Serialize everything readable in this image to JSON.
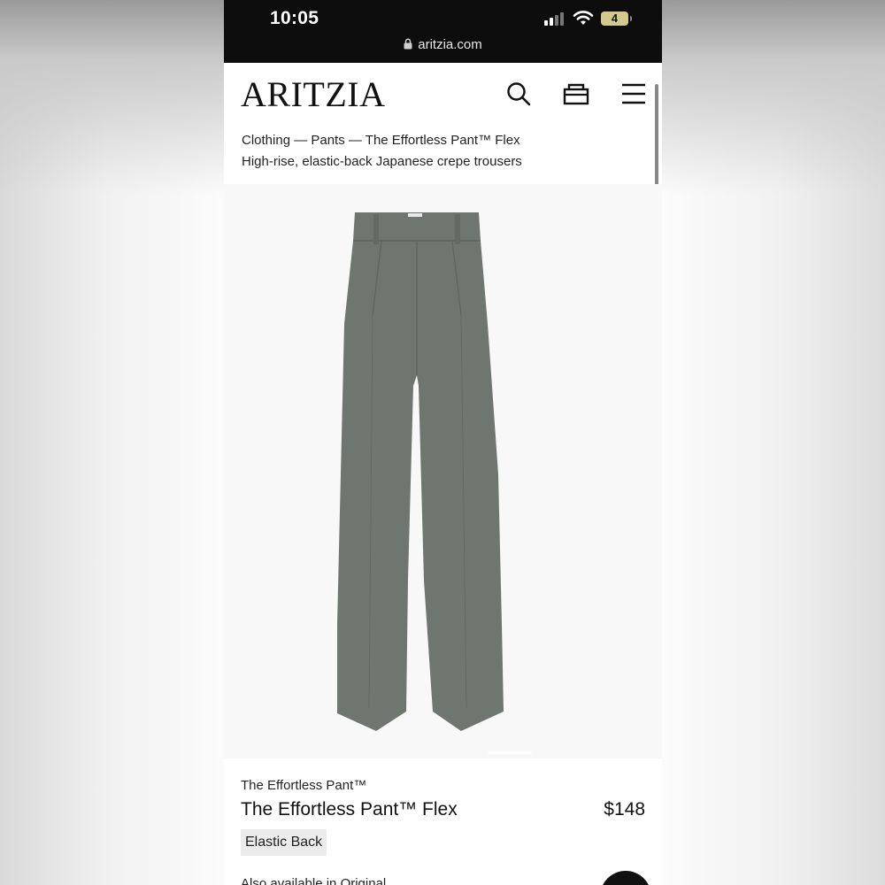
{
  "status_bar": {
    "time": "10:05",
    "battery_level": "4",
    "icons": [
      "signal-icon",
      "wifi-icon",
      "battery-icon"
    ],
    "url": "aritzia.com"
  },
  "header": {
    "logo": "ARITZIA",
    "icons": [
      "search-icon",
      "shopping-bag-icon",
      "menu-icon"
    ],
    "breadcrumb": "Clothing — Pants — The Effortless Pant™ Flex",
    "subtitle": "High-rise, elastic-back Japanese crepe trousers"
  },
  "product": {
    "image_color": "#6f756f",
    "brand_line": "The Effortless Pant™",
    "name": "The Effortless Pant™ Flex",
    "price": "$148",
    "tag": "Elastic Back",
    "also_available": "Also available in Original"
  },
  "colors": {
    "status_bar_bg": "#0d0d0d",
    "text": "#111111",
    "tag_bg": "#ececec"
  }
}
